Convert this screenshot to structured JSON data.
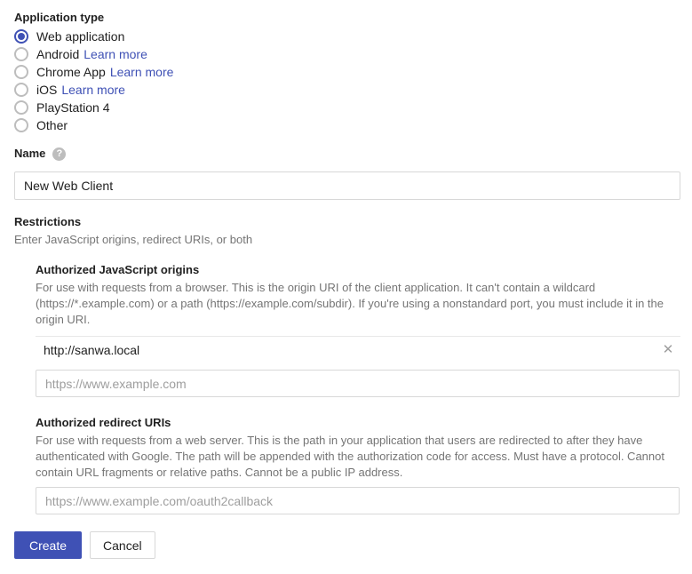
{
  "app_type": {
    "heading": "Application type",
    "options": [
      {
        "label": "Web application",
        "selected": true,
        "link": ""
      },
      {
        "label": "Android",
        "selected": false,
        "link": "Learn more"
      },
      {
        "label": "Chrome App",
        "selected": false,
        "link": "Learn more"
      },
      {
        "label": "iOS",
        "selected": false,
        "link": "Learn more"
      },
      {
        "label": "PlayStation 4",
        "selected": false,
        "link": ""
      },
      {
        "label": "Other",
        "selected": false,
        "link": ""
      }
    ]
  },
  "name": {
    "label": "Name",
    "help_icon": "help-icon",
    "help_glyph": "?",
    "value": "New Web Client",
    "placeholder": ""
  },
  "restrictions": {
    "heading": "Restrictions",
    "helper": "Enter JavaScript origins, redirect URIs, or both",
    "javascript_origins": {
      "title": "Authorized JavaScript origins",
      "description": "For use with requests from a browser. This is the origin URI of the client application. It can't contain a wildcard (https://*.example.com) or a path (https://example.com/subdir). If you're using a nonstandard port, you must include it in the origin URI.",
      "entries": [
        {
          "value": "http://sanwa.local",
          "remove_glyph": "✕"
        }
      ],
      "input_placeholder": "https://www.example.com",
      "input_value": ""
    },
    "redirect_uris": {
      "title": "Authorized redirect URIs",
      "description": "For use with requests from a web server. This is the path in your application that users are redirected to after they have authenticated with Google. The path will be appended with the authorization code for access. Must have a protocol. Cannot contain URL fragments or relative paths. Cannot be a public IP address.",
      "input_placeholder": "https://www.example.com/oauth2callback",
      "input_value": ""
    }
  },
  "buttons": {
    "create": "Create",
    "cancel": "Cancel"
  },
  "colors": {
    "accent": "#3f51b5",
    "link": "#3f51b5",
    "text": "#212121",
    "muted": "#757575",
    "border": "#d8d8d8"
  }
}
